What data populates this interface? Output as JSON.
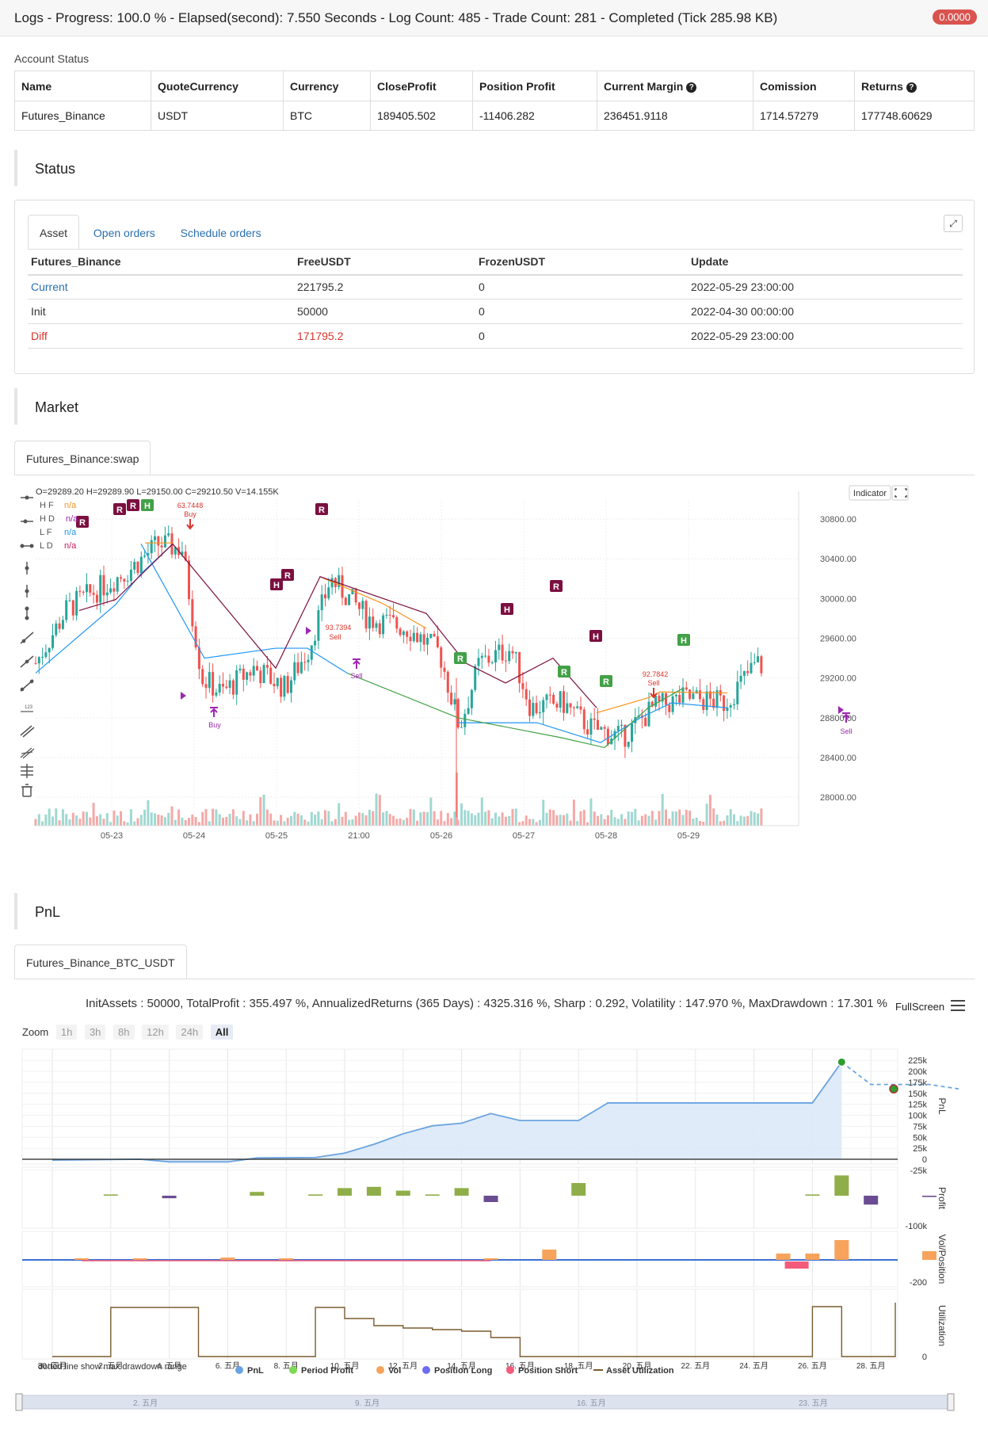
{
  "topbar": {
    "title": "Logs - Progress: 100.0 % - Elapsed(second): 7.550 Seconds - Log Count: 485 - Trade Count: 281 - Completed (Tick 285.98 KB)",
    "badge": "0.0000"
  },
  "account": {
    "label": "Account Status",
    "headers": [
      "Name",
      "QuoteCurrency",
      "Currency",
      "CloseProfit",
      "Position Profit",
      "Current Margin",
      "Comission",
      "Returns"
    ],
    "row": [
      "Futures_Binance",
      "USDT",
      "BTC",
      "189405.502",
      "-11406.282",
      "236451.9118",
      "1714.57279",
      "177748.60629"
    ]
  },
  "status": {
    "title": "Status",
    "tabs": [
      "Asset",
      "Open orders",
      "Schedule orders"
    ],
    "expand_icon": "expand-icon",
    "headers": [
      "Futures_Binance",
      "FreeUSDT",
      "FrozenUSDT",
      "Update"
    ],
    "rows": [
      [
        "Current",
        "221795.2",
        "0",
        "2022-05-29 23:00:00"
      ],
      [
        "Init",
        "50000",
        "0",
        "2022-04-30 00:00:00"
      ],
      [
        "Diff",
        "171795.2",
        "0",
        "2022-05-29 23:00:00"
      ]
    ]
  },
  "market": {
    "title": "Market",
    "tab": "Futures_Binance:swap",
    "ohlc": "O=29289.20 H=29289.90 L=29150.00 C=29210.50 V=14.155K",
    "indicator_button": "Indicator",
    "legend": [
      {
        "name": "H F",
        "value": "n/a",
        "color": "#f7941d"
      },
      {
        "name": "H D",
        "value": "n/a",
        "color": "#9c27b0"
      },
      {
        "name": "L F",
        "value": "n/a",
        "color": "#2196f3"
      },
      {
        "name": "L D",
        "value": "n/a",
        "color": "#c2185b"
      }
    ],
    "price_ticks": [
      "30800.00",
      "30400.00",
      "30000.00",
      "29600.00",
      "29200.00",
      "28800.00",
      "28400.00",
      "28000.00"
    ],
    "date_ticks": [
      "05-23",
      "05-24",
      "05-25",
      "21:00",
      "05-26",
      "05-27",
      "05-28",
      "05-29"
    ],
    "annotations": [
      {
        "price": "63.7448",
        "label": "Buy"
      },
      {
        "price": "93.7394",
        "label": "Sell"
      },
      {
        "price": "92.7842",
        "label": "Sell"
      },
      {
        "label": "Buy"
      },
      {
        "label": "Sell"
      },
      {
        "label": "Sell"
      }
    ],
    "markers": [
      "R",
      "H"
    ],
    "colors": {
      "up": "#26a69a",
      "down": "#ef5350",
      "hf": "#f7941d",
      "lf": "#2196f3",
      "hd": "#7b1040",
      "ld": "#43a047"
    }
  },
  "pnl": {
    "title": "PnL",
    "tab": "Futures_Binance_BTC_USDT",
    "summary": "InitAssets : 50000, TotalProfit : 355.497 %, AnnualizedReturns (365 Days) : 4325.316 %, Sharp : 0.292, Volatility : 147.970 %, MaxDrawdown : 17.301 %",
    "fullscreen": "FullScreen",
    "zoom_label": "Zoom",
    "zoom_buttons": [
      "1h",
      "3h",
      "8h",
      "12h",
      "24h",
      "All"
    ],
    "pnl_ticks": [
      "225k",
      "200k",
      "175k",
      "150k",
      "125k",
      "100k",
      "75k",
      "50k",
      "25k",
      "0",
      "-25k"
    ],
    "profit_tick": "-100k",
    "vol_tick": "-200",
    "util_tick": "0",
    "axis_titles": [
      "PnL",
      "Profit",
      "Vol/Position",
      "Utilization"
    ],
    "date_ticks": [
      "30. 四月",
      "2. 五月",
      "4. 五月",
      "6. 五月",
      "8. 五月",
      "10. 五月",
      "12. 五月",
      "14. 五月",
      "16. 五月",
      "18. 五月",
      "20. 五月",
      "22. 五月",
      "24. 五月",
      "26. 五月",
      "28. 五月"
    ],
    "navigator_ticks": [
      "2. 五月",
      "9. 五月",
      "16. 五月",
      "23. 五月"
    ],
    "legend_note": "dotted line show max drawdown range",
    "legend": [
      {
        "name": "PnL",
        "color": "#6aa4e0"
      },
      {
        "name": "Period Profit",
        "color": "#7ed957"
      },
      {
        "name": "Vol",
        "color": "#f7a35c"
      },
      {
        "name": "Position Long",
        "color": "#6d6df0"
      },
      {
        "name": "Position Short",
        "color": "#f45b7a"
      },
      {
        "name": "Asset Utilization",
        "color": "#7a5c2e"
      }
    ]
  }
}
